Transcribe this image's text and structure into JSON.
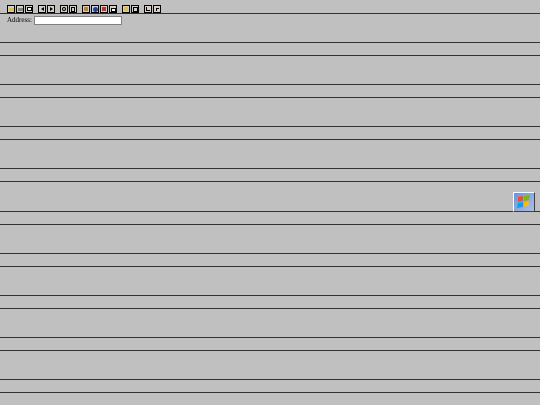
{
  "address_bar": {
    "label": "Address:",
    "value": "",
    "placeholder": ""
  },
  "toolbar": {
    "buttons": [
      {
        "icon": "open-icon"
      },
      {
        "icon": "print-icon"
      },
      {
        "icon": "stop-icon"
      },
      {
        "icon": "back-icon"
      },
      {
        "icon": "forward-icon"
      },
      {
        "icon": "refresh-icon"
      },
      {
        "icon": "home-icon"
      },
      {
        "icon": "search-icon"
      },
      {
        "icon": "globe-icon"
      },
      {
        "icon": "favorites-icon"
      },
      {
        "icon": "mail-icon"
      },
      {
        "icon": "view-icon"
      },
      {
        "icon": "frames-icon"
      },
      {
        "icon": "font-larger-icon"
      },
      {
        "icon": "font-smaller-icon"
      }
    ]
  },
  "branding": {
    "logo_icon": "windows-logo-icon",
    "logo_colors": [
      "#f25022",
      "#7fba00",
      "#00a4ef",
      "#ffb900"
    ]
  },
  "colors": {
    "background": "#c0c0c0",
    "rule_line": "#333333"
  }
}
